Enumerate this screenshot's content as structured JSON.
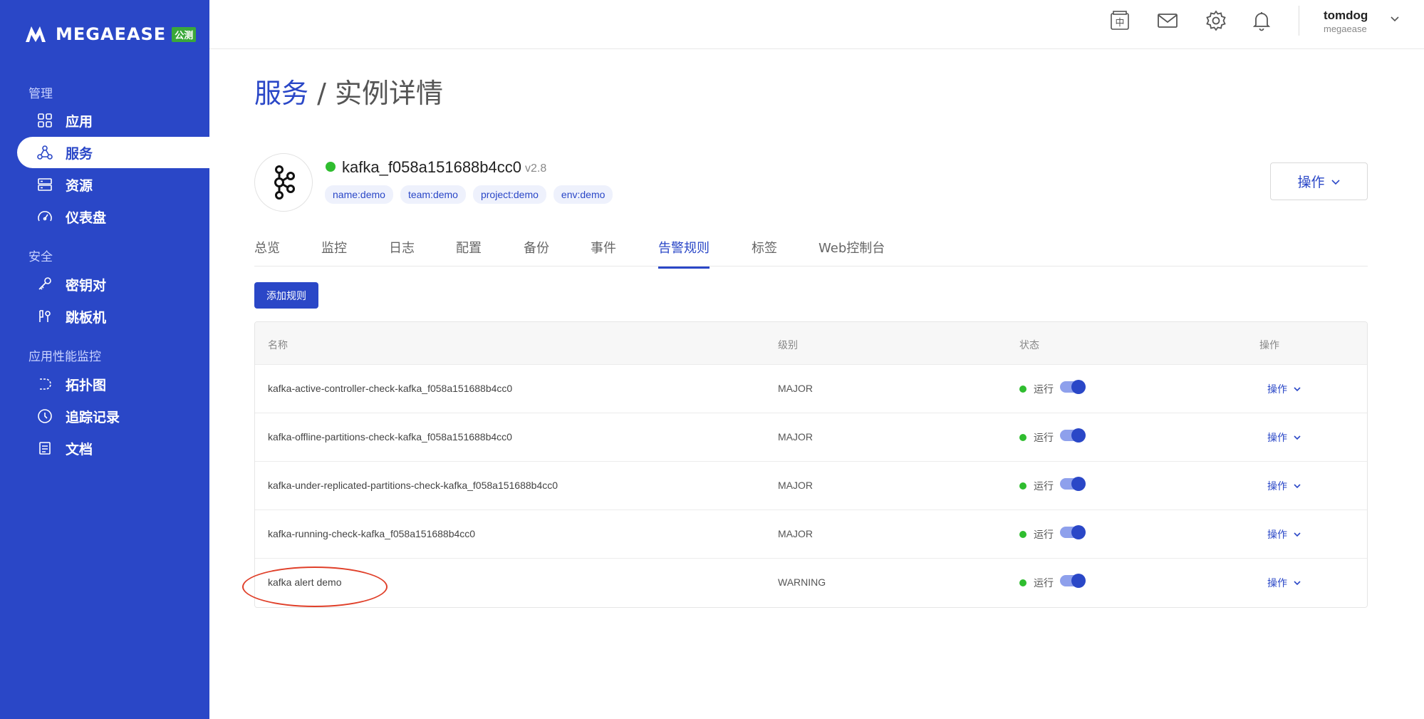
{
  "brand": {
    "name": "MEGAEASE",
    "badge": "公测"
  },
  "sidebar": {
    "sections": [
      {
        "label": "管理"
      },
      {
        "label": "安全"
      },
      {
        "label": "应用性能监控"
      }
    ],
    "items": [
      {
        "label": "应用",
        "icon": "apps-grid-icon"
      },
      {
        "label": "服务",
        "icon": "service-nodes-icon",
        "active": true
      },
      {
        "label": "资源",
        "icon": "server-stack-icon"
      },
      {
        "label": "仪表盘",
        "icon": "gauge-icon"
      },
      {
        "label": "密钥对",
        "icon": "key-icon"
      },
      {
        "label": "跳板机",
        "icon": "bastion-icon"
      },
      {
        "label": "拓扑图",
        "icon": "topology-icon"
      },
      {
        "label": "追踪记录",
        "icon": "clock-icon"
      },
      {
        "label": "文档",
        "icon": "document-icon"
      }
    ]
  },
  "topbar": {
    "icons": [
      "language-zh-icon",
      "mail-icon",
      "gear-icon",
      "bell-icon"
    ],
    "language_glyph": "中",
    "user": {
      "name": "tomdog",
      "org": "megaease"
    }
  },
  "breadcrumb": {
    "parent": "服务",
    "separator": " / ",
    "current": "实例详情"
  },
  "instance": {
    "name": "kafka_f058a151688b4cc0",
    "version": "v2.8",
    "status_color": "#2fbd2f",
    "tags": [
      "name:demo",
      "team:demo",
      "project:demo",
      "env:demo"
    ],
    "ops_label": "操作"
  },
  "tabs": [
    {
      "label": "总览"
    },
    {
      "label": "监控"
    },
    {
      "label": "日志"
    },
    {
      "label": "配置"
    },
    {
      "label": "备份"
    },
    {
      "label": "事件"
    },
    {
      "label": "告警规则",
      "active": true
    },
    {
      "label": "标签"
    },
    {
      "label": "Web控制台"
    }
  ],
  "add_rule_label": "添加规则",
  "table": {
    "headers": {
      "name": "名称",
      "level": "级别",
      "status": "状态",
      "ops": "操作"
    },
    "rows": [
      {
        "name": "kafka-active-controller-check-kafka_f058a151688b4cc0",
        "level": "MAJOR",
        "status": "运行",
        "enabled": true,
        "ops": "操作"
      },
      {
        "name": "kafka-offline-partitions-check-kafka_f058a151688b4cc0",
        "level": "MAJOR",
        "status": "运行",
        "enabled": true,
        "ops": "操作"
      },
      {
        "name": "kafka-under-replicated-partitions-check-kafka_f058a151688b4cc0",
        "level": "MAJOR",
        "status": "运行",
        "enabled": true,
        "ops": "操作"
      },
      {
        "name": "kafka-running-check-kafka_f058a151688b4cc0",
        "level": "MAJOR",
        "status": "运行",
        "enabled": true,
        "ops": "操作"
      },
      {
        "name": "kafka alert demo",
        "level": "WARNING",
        "status": "运行",
        "enabled": true,
        "ops": "操作"
      }
    ]
  },
  "colors": {
    "primary": "#2a47c7",
    "sidebar_bg": "#2a47c7",
    "running": "#2fbd2f",
    "annotation": "#e0402a"
  }
}
